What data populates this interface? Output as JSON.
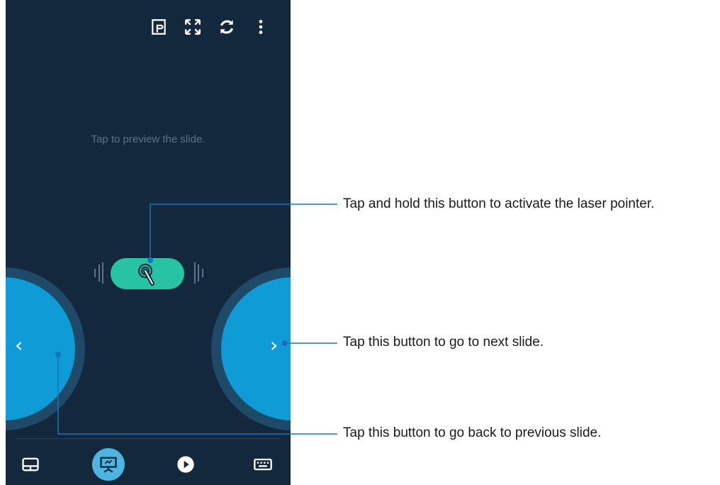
{
  "screen": {
    "hint_text": "Tap to preview the slide."
  },
  "topbar": {
    "icons": [
      "presentation-view-icon",
      "fullscreen-icon",
      "refresh-icon",
      "more-vert-icon"
    ]
  },
  "controls": {
    "laser_icon": "laser-pointer-icon",
    "prev_label": "‹",
    "next_label": "›"
  },
  "bottom_nav": {
    "icons": [
      "touchpad-icon",
      "presentation-icon",
      "play-icon",
      "keyboard-icon"
    ],
    "active_index": 1
  },
  "callouts": {
    "laser": "Tap and hold this button to activate the laser pointer.",
    "next": "Tap this button to go to next slide.",
    "prev": "Tap this button to go back to previous slide."
  },
  "colors": {
    "screen_bg": "#13283c",
    "nav_blue": "#0f9bd6",
    "laser_green": "#27c3a4",
    "active_tab": "#4db5e0"
  }
}
